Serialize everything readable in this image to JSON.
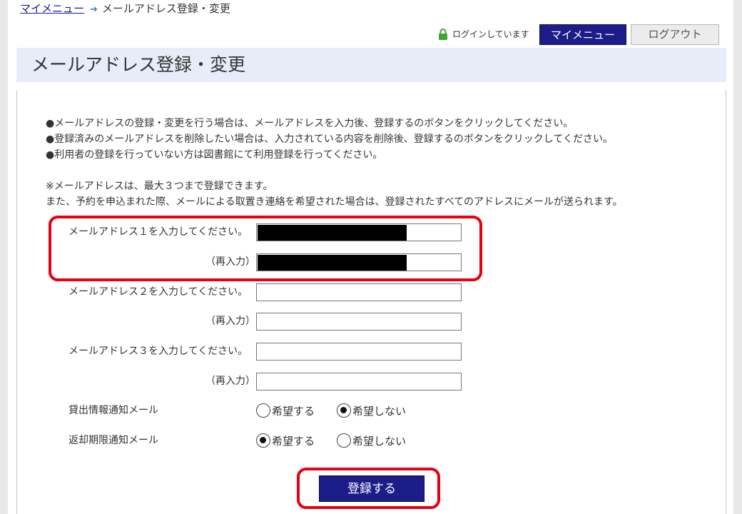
{
  "breadcrumb": {
    "home": "マイメニュー",
    "separator": "➔",
    "current": "メールアドレス登録・変更"
  },
  "header": {
    "login_status": "ログインしています",
    "mymenu_button": "マイメニュー",
    "logout_button": "ログアウト"
  },
  "page_title": "メールアドレス登録・変更",
  "instructions": [
    "●メールアドレスの登録・変更を行う場合は、メールアドレスを入力後、登録するのボタンをクリックしてください。",
    "●登録済みのメールアドレスを削除したい場合は、入力されている内容を削除後、登録するのボタンをクリックしてください。",
    "●利用者の登録を行っていない方は図書館にて利用登録を行ってください。"
  ],
  "note": [
    "※メールアドレスは、最大３つまで登録できます。",
    "また、予約を申込まれた際、メールによる取置き連絡を希望された場合は、登録されたすべてのアドレスにメールが送られます。"
  ],
  "form": {
    "email1_label": "メールアドレス１を入力してください。",
    "email1_confirm_label": "（再入力）",
    "email2_label": "メールアドレス２を入力してください。",
    "email2_confirm_label": "（再入力）",
    "email3_label": "メールアドレス３を入力してください。",
    "email3_confirm_label": "（再入力）",
    "email1_value": "",
    "email1_confirm_value": "",
    "email2_value": "",
    "email2_confirm_value": "",
    "email3_value": "",
    "email3_confirm_value": ""
  },
  "notifications": {
    "lending": {
      "label": "貸出情報通知メール",
      "option_yes": "希望する",
      "option_no": "希望しない",
      "selected": "no"
    },
    "return_due": {
      "label": "返却期限通知メール",
      "option_yes": "希望する",
      "option_no": "希望しない",
      "selected": "yes"
    }
  },
  "submit_label": "登録する",
  "colors": {
    "primary_button": "#1d1d8a",
    "title_bar": "#e6edf9",
    "highlight": "#e60012"
  }
}
